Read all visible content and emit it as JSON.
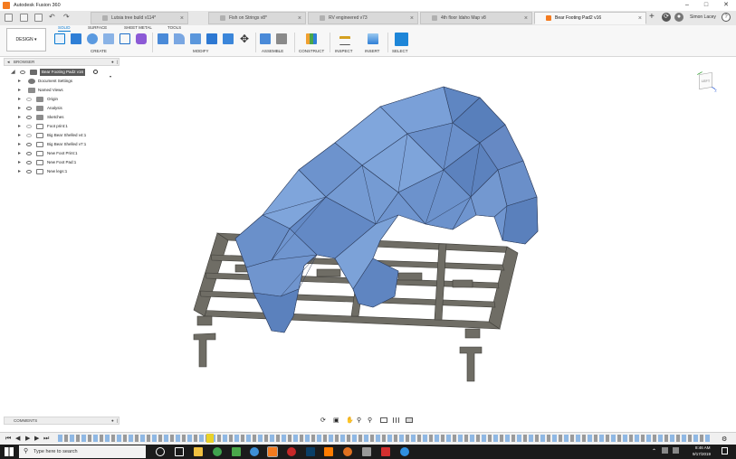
{
  "window": {
    "title": "Autodesk Fusion 360",
    "user": "Simon Lacey"
  },
  "tabs": [
    {
      "label": "Lutsia tree build v114*"
    },
    {
      "label": "Fish on Strings v8*"
    },
    {
      "label": "RV engineered v73"
    },
    {
      "label": "4th floor Idaho Map v8"
    },
    {
      "label": "Bear Footing Pad2 v16"
    }
  ],
  "toolbar": {
    "workspace": "DESIGN",
    "tabs": [
      "SOLID",
      "SURFACE",
      "SHEET METAL",
      "TOOLS"
    ],
    "groups": [
      "CREATE",
      "MODIFY",
      "ASSEMBLE",
      "CONSTRUCT",
      "INSPECT",
      "INSERT",
      "SELECT"
    ]
  },
  "browser": {
    "header": "BROWSER",
    "root": "Bear Footing Pad2 v16",
    "items": [
      {
        "label": "Document Settings",
        "icon": "gear-icon"
      },
      {
        "label": "Named Views",
        "icon": "folder-icon"
      },
      {
        "label": "Origin",
        "icon": "folder-icon"
      },
      {
        "label": "Analysis",
        "icon": "folder-icon"
      },
      {
        "label": "Sketches",
        "icon": "folder-icon"
      },
      {
        "label": "Foot print:1",
        "icon": "component-icon"
      },
      {
        "label": "Big Bear Shelled v4:1",
        "icon": "component-icon"
      },
      {
        "label": "Big Bear Shelled v7:1",
        "icon": "component-icon"
      },
      {
        "label": "New Foot Print:1",
        "icon": "component-icon"
      },
      {
        "label": "New Foot Pad:1",
        "icon": "component-icon"
      },
      {
        "label": "New legs:1",
        "icon": "component-icon"
      }
    ]
  },
  "viewcube": {
    "face": "LEFT",
    "axis": "Z"
  },
  "comments": {
    "label": "COMMENTS"
  },
  "taskbar": {
    "search_placeholder": "Type here to search",
    "time": "8:46 AM",
    "date": "9/17/2019"
  },
  "colors": {
    "accent": "#0a7ad1",
    "model_blue": "#6f95cf",
    "frame_gray": "#6f6d65",
    "taskbar": "#1b1b1b"
  }
}
